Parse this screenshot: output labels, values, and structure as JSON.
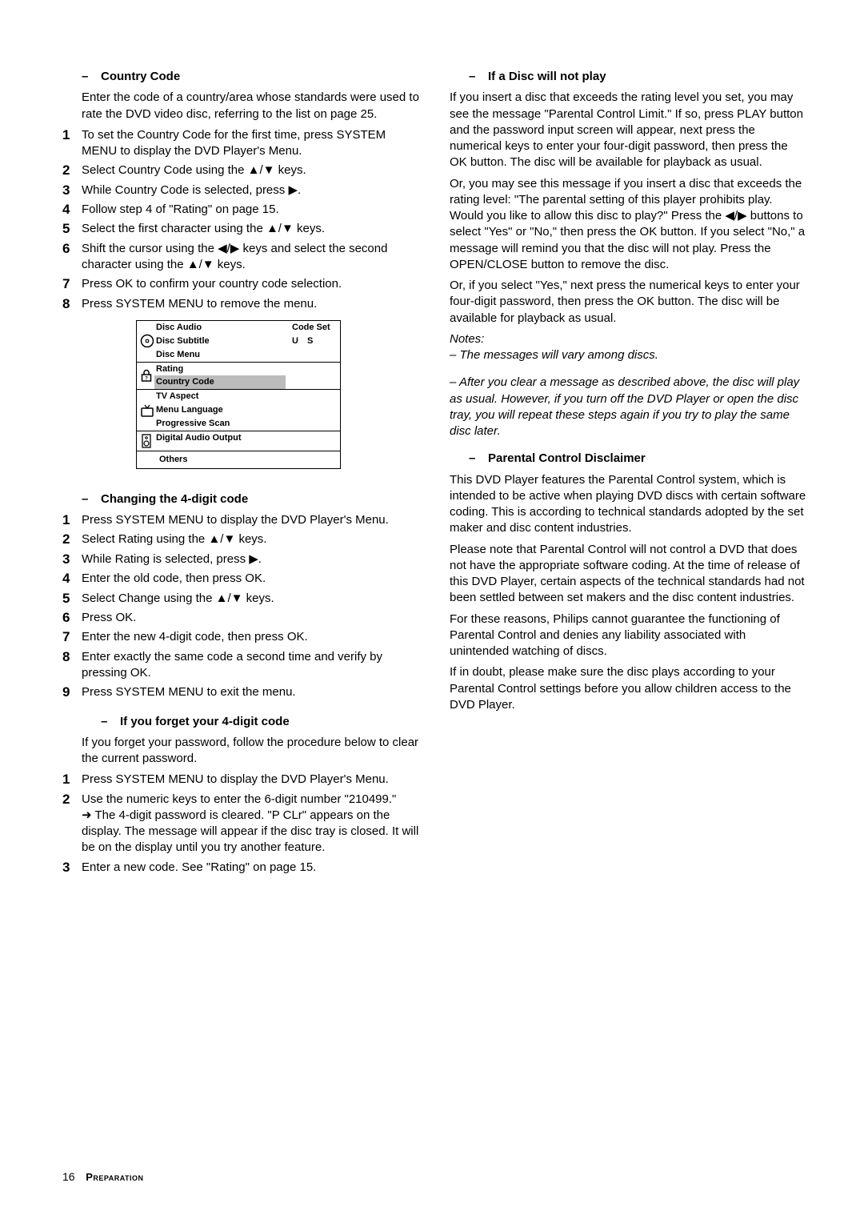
{
  "col1": {
    "h1": {
      "dash": "–",
      "title": "Country Code"
    },
    "p1": "Enter the code of a country/area whose standards were used to rate the DVD video disc, referring to the list  on page 25.",
    "steps1": [
      "To set the Country Code for the first time, press SYSTEM MENU to display the DVD Player's Menu.",
      "Select Country Code using the ▲/▼ keys.",
      "While Country Code is selected, press ▶.",
      "Follow step 4 of \"Rating\" on page 15.",
      "Select the first character using the ▲/▼ keys.",
      "Shift the cursor using the ◀/▶ keys and select the second character using the ▲/▼ keys.",
      "Press OK to confirm your country code selection.",
      "Press SYSTEM MENU to remove the menu."
    ],
    "menu": {
      "codeSetLabel": "Code Set",
      "codeSetValue": "U   S",
      "group1": [
        "Disc Audio",
        "Disc Subtitle",
        "Disc Menu"
      ],
      "group2": [
        "Rating",
        "Country Code"
      ],
      "group3": [
        "TV Aspect",
        "Menu Language",
        "Progressive Scan"
      ],
      "group4": [
        "Digital Audio Output"
      ],
      "others": "Others"
    },
    "h2": {
      "dash": "–",
      "title": "Changing the 4-digit code"
    },
    "steps2": [
      "Press SYSTEM MENU to display the DVD Player's Menu.",
      "Select Rating using the ▲/▼ keys.",
      "While Rating is selected, press ▶.",
      "Enter the old code, then press OK.",
      "Select Change using the ▲/▼ keys.",
      "Press OK.",
      "Enter the new 4-digit code, then press OK.",
      "Enter exactly the same code a second time and verify by pressing OK.",
      "Press SYSTEM MENU to exit the menu."
    ],
    "h3": {
      "dash": "–",
      "title": "If you forget your 4-digit code"
    },
    "p3": "If you forget your password, follow the procedure below to clear the current password.",
    "steps3": {
      "s1": "Press SYSTEM MENU to display the DVD Player's Menu.",
      "s2a": "Use the numeric keys to enter the 6-digit number \"210499.\"",
      "s2b": "➜ The 4-digit password is cleared. \"P CLr\" appears on the display. The message will appear if the disc tray is closed. It will be on the display until you try another feature.",
      "s3": "Enter a new code. See \"Rating\" on page 15."
    }
  },
  "col2": {
    "h1": {
      "dash": "–",
      "title": "If a Disc will not play"
    },
    "p1": "If you insert a disc that exceeds the rating level you set, you may see the message \"Parental Control Limit.\"  If so, press PLAY button and the password input screen will appear, next press the numerical keys to enter your four-digit password, then press the OK button. The disc will be available for playback as usual.",
    "p2": "Or, you may see this message if you insert a disc that exceeds the rating level: \"The parental setting of this player prohibits play. Would you like to allow this disc to play?\" Press the ◀/▶ buttons to select \"Yes\" or \"No,\"  then press the OK button. If you select \"No,\" a message will remind you that the disc will not play. Press the OPEN/CLOSE button to remove the disc.",
    "p3": "Or, if you select \"Yes,\" next press the numerical keys to enter your four-digit password, then press the OK button. The disc will be available for playback as usual.",
    "notesHead": "Notes:",
    "note1": "–  The messages will vary among discs.",
    "note2": "–  After you clear a message as described above, the disc will play as usual. However, if you turn off the DVD Player or open the disc tray, you will repeat these steps again if you try to play the same disc later.",
    "h2": {
      "dash": "–",
      "title": "Parental Control Disclaimer"
    },
    "pc1": "This DVD Player features the Parental Control system, which is intended to be active when playing DVD discs with certain software coding. This is according to technical standards adopted by the set maker and disc content industries.",
    "pc2": "Please note that Parental Control will not control a DVD that does not have the appropriate software coding. At the time of release of this DVD Player, certain aspects of the technical standards had not been settled between set makers and the disc content industries.",
    "pc3": "For these reasons, Philips cannot guarantee the functioning of Parental Control and denies any liability associated with unintended watching of discs.",
    "pc4": "If in doubt, please make sure the disc plays according to your Parental Control settings before you allow children access to the DVD Player."
  },
  "footer": {
    "page": "16",
    "section": "Preparation"
  }
}
